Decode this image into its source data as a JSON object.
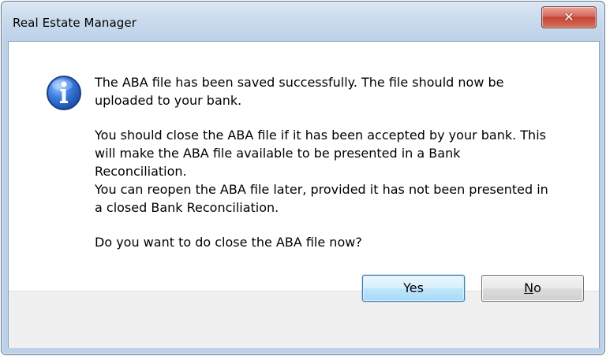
{
  "window": {
    "title": "Real Estate Manager",
    "close_glyph": "✕"
  },
  "dialog": {
    "icon": "info-icon",
    "messages": [
      "The ABA file has been saved successfully. The file should now be\nuploaded to your bank.",
      "You should close the ABA file if it has been accepted by your bank. This\nwill make the ABA file available to be presented in a Bank\nReconciliation.\nYou can reopen the ABA file later, provided it has not been presented in\na closed Bank Reconciliation.",
      "Do you want to do close the ABA file now?"
    ]
  },
  "buttons": {
    "yes_label": "Yes",
    "no_label": "No",
    "no_mnemonic": "N",
    "no_rest": "o"
  },
  "colors": {
    "accent": "#3c7fb1",
    "info_icon": "#2a5fb8",
    "close": "#c44533"
  }
}
